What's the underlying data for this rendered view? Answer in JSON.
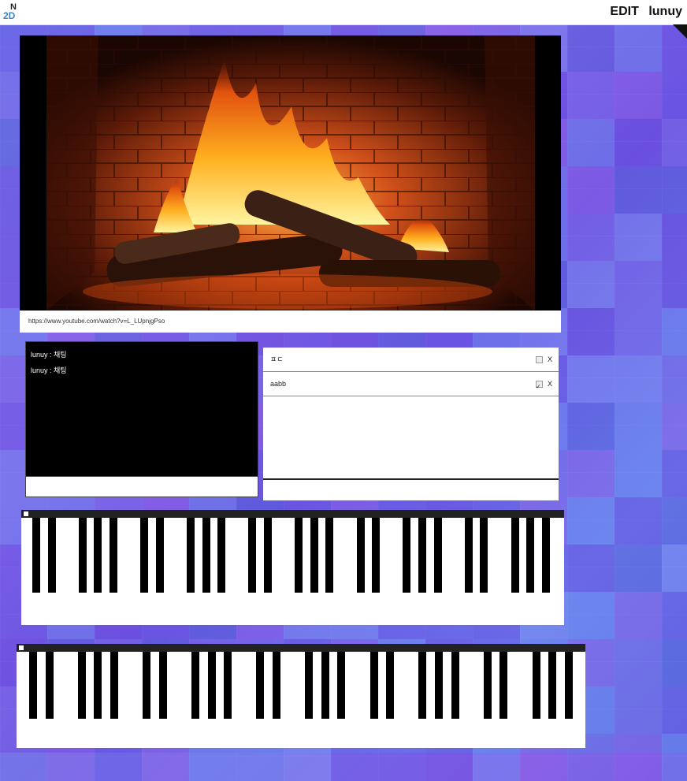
{
  "header": {
    "logo_n": "N",
    "logo_2d": "2D",
    "edit_label": "EDIT",
    "username": "lunuy"
  },
  "video": {
    "url": "https://www.youtube.com/watch?v=L_LUpnjgPso"
  },
  "chat": {
    "messages": [
      "lunuy : 채팅",
      "lunuy : 채팅"
    ],
    "input_value": ""
  },
  "todo": {
    "items": [
      {
        "text": "ㅍㄷ",
        "checked": false,
        "delete_label": "X"
      },
      {
        "text": "aabb",
        "checked": true,
        "delete_label": "X"
      }
    ],
    "input_value": ""
  },
  "colors": {
    "background_tiles": [
      "#6f86ee",
      "#7a6ce8",
      "#8a62e8",
      "#6a5ae4",
      "#5a63db",
      "#7d8af0",
      "#6950de"
    ],
    "video_bg": "#000000",
    "chat_bg": "#000000",
    "piano_bar": "#222222"
  }
}
